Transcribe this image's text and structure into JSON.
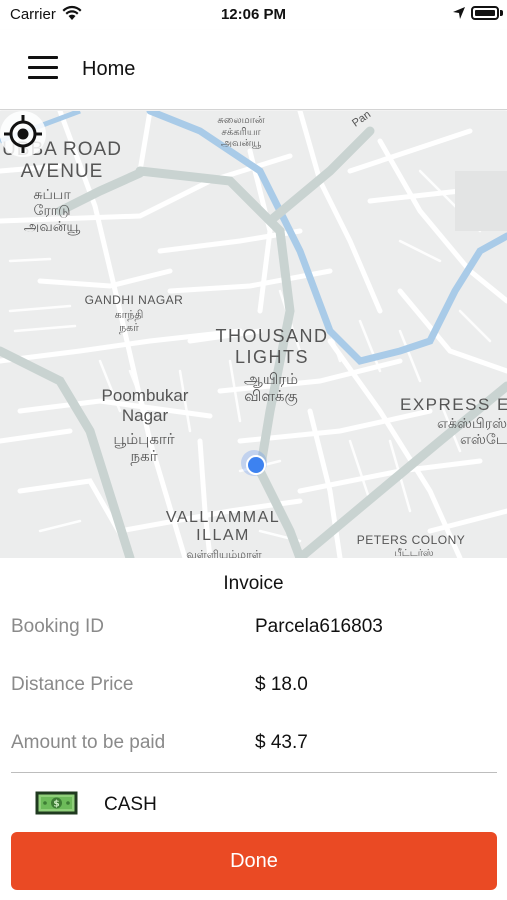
{
  "status_bar": {
    "carrier": "Carrier",
    "time": "12:06 PM"
  },
  "nav": {
    "title": "Home",
    "menu_icon": "hamburger-menu-icon"
  },
  "map": {
    "labels": {
      "subba_road_en": "UBBA ROAD\nAVENUE",
      "subba_road_ta": "சுப்பா\nரோடு\nஅவன்யூ",
      "top_ta": "சுலைமான்\nசக்கரியா\nஅவன்யூ",
      "road_pan": "Pan",
      "gandhi_en": "GANDHI NAGAR",
      "gandhi_ta": "காந்தி\nநகர்",
      "thousand_en": "THOUSAND\nLIGHTS",
      "thousand_ta": "ஆயிரம்\nவிளக்கு",
      "poombukar_en": "Poombukar\nNagar",
      "poombukar_ta": "பூம்புகார்\nநகர்",
      "express_en": "EXPRESS E",
      "express_ta": "எக்ஸ்பிரஸ்\nஎஸ்டே",
      "valliammal_en": "VALLIAMMAL\nILLAM",
      "valliammal_ta": "வள்ளியம்மாள்",
      "peters_en": "PETERS COLONY",
      "peters_ta": "பீட்டர்ஸ்"
    },
    "colors": {
      "land": "#eceded",
      "road": "#ffffff",
      "river": "#a9cbe8",
      "major_road": "#c9d3d1"
    }
  },
  "invoice": {
    "title": "Invoice",
    "rows": [
      {
        "label": "Booking ID",
        "value": "Parcela616803"
      },
      {
        "label": "Distance Price",
        "value": "$ 18.0"
      },
      {
        "label": "Amount to be paid",
        "value": "$ 43.7"
      }
    ],
    "payment_method": "CASH",
    "payment_icon": "cash-icon",
    "done_label": "Done",
    "accent_color": "#ea4a24"
  }
}
